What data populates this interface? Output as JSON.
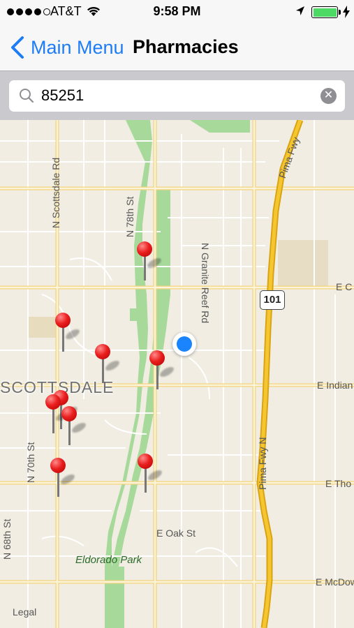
{
  "status_bar": {
    "carrier": "AT&T",
    "time": "9:58 PM",
    "battery_level": 1.0
  },
  "nav": {
    "back_label": "Main Menu",
    "title": "Pharmacies"
  },
  "search": {
    "value": "85251"
  },
  "map": {
    "streets": {
      "n_scottsdale_rd": "N Scottsdale Rd",
      "n_78th_st": "N 78th St",
      "n_granite_reef_rd": "N Granite Reef Rd",
      "pima_fwy_top": "Pima Fwy",
      "pima_fwy_n": "Pima Fwy N",
      "n_70th_st": "N 70th St",
      "n_68th_st": "N 68th St",
      "e_oak_st": "E Oak St",
      "e_c": "E C",
      "e_indian": "E Indian",
      "e_tho": "E Tho",
      "e_mcdow": "E McDow"
    },
    "city_label": "SCOTTSDALE",
    "park_label": "Eldorado Park",
    "highway_shield": "101",
    "legal": "Legal",
    "pharmacy_pin_count": 9
  },
  "colors": {
    "accent": "#1e7cf5",
    "pin": "#ea1f1f",
    "freeway": "#f6c631",
    "park": "#a7d99b",
    "user_location": "#1a84ff"
  },
  "icons": {
    "back": "chevron-left-icon",
    "search": "search-icon",
    "clear": "clear-icon",
    "wifi": "wifi-icon",
    "location": "location-arrow-icon"
  }
}
